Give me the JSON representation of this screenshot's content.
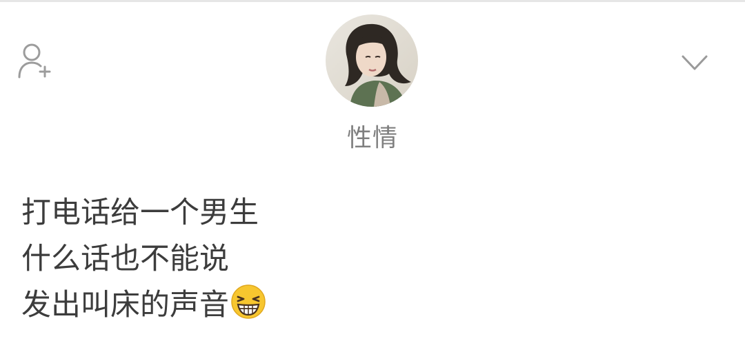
{
  "profile": {
    "username": "性情",
    "avatar_icon": "avatar-photo",
    "follow_icon": "add-user-icon",
    "dropdown_icon": "chevron-down-icon"
  },
  "post": {
    "lines": [
      "打电话给一个男生",
      "什么话也不能说",
      "发出叫床的声音"
    ],
    "trailing_emoji": "grinning-squint-emoji"
  },
  "colors": {
    "username": "#7f7f7f",
    "post_text": "#3c3c3c",
    "icon": "#9a9a9a",
    "emoji_face": "#f7c62f"
  }
}
